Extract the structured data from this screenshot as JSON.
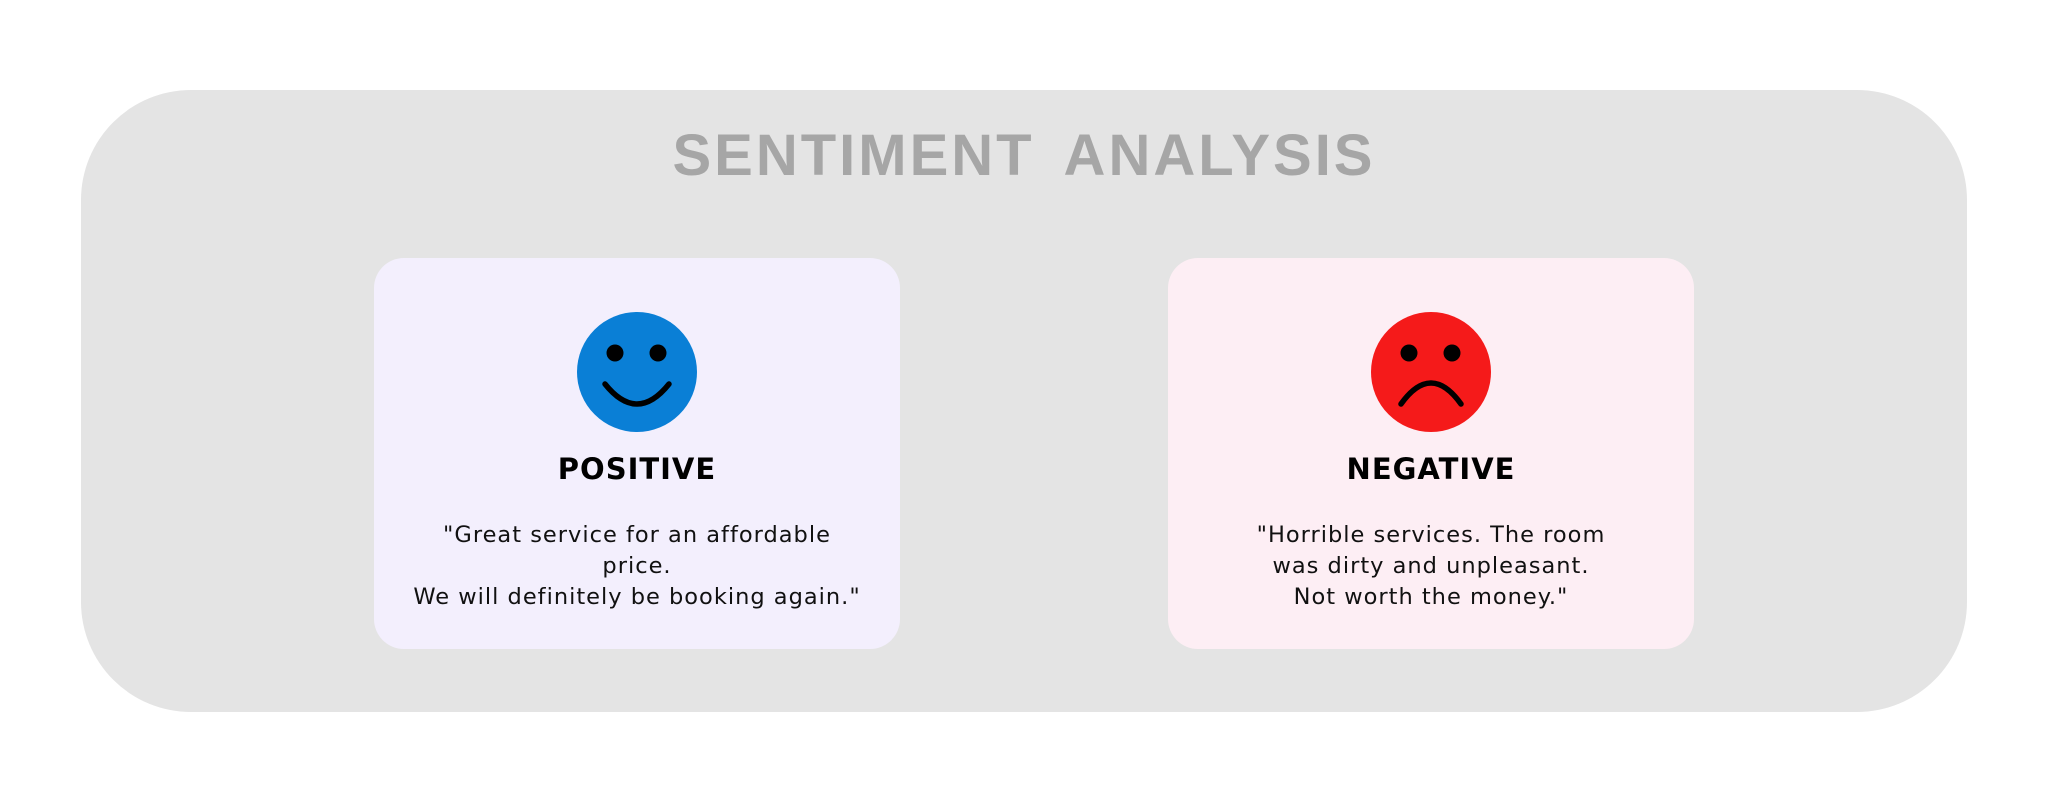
{
  "title": "SENTIMENT  ANALYSIS",
  "colors": {
    "outer_panel": "#e4e4e4",
    "title": "#a6a6a6",
    "positive_card": "#f3effd",
    "negative_card": "#fdeef4",
    "positive_face": "#0a7fd6",
    "negative_face": "#f51a1a"
  },
  "cards": {
    "positive": {
      "icon": "smiley-face-icon",
      "label": "POSITIVE",
      "quote_lines": [
        "\"Great service for an affordable",
        "price.",
        "We will definitely be booking again.\""
      ]
    },
    "negative": {
      "icon": "frowning-face-icon",
      "label": "NEGATIVE",
      "quote_lines": [
        "\"Horrible services. The room",
        "was dirty and unpleasant.",
        "Not worth the money.\""
      ]
    }
  }
}
